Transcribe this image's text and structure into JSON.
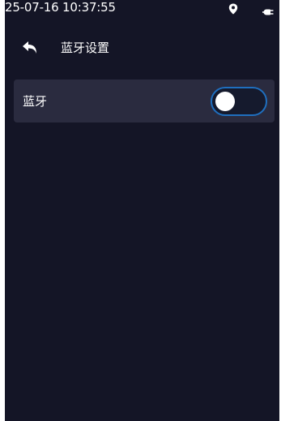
{
  "status_bar": {
    "time": "25-07-16 10:37:55",
    "location_icon": "location-pin-icon",
    "power_icon": "power-plug-icon"
  },
  "header": {
    "back_icon": "back-arrow-icon",
    "title": "蓝牙设置"
  },
  "settings": {
    "bluetooth": {
      "label": "蓝牙",
      "enabled": false
    }
  },
  "colors": {
    "background": "#141526",
    "row_background": "#2a2b3f",
    "toggle_border": "#1f6fbf",
    "text": "#ffffff"
  }
}
